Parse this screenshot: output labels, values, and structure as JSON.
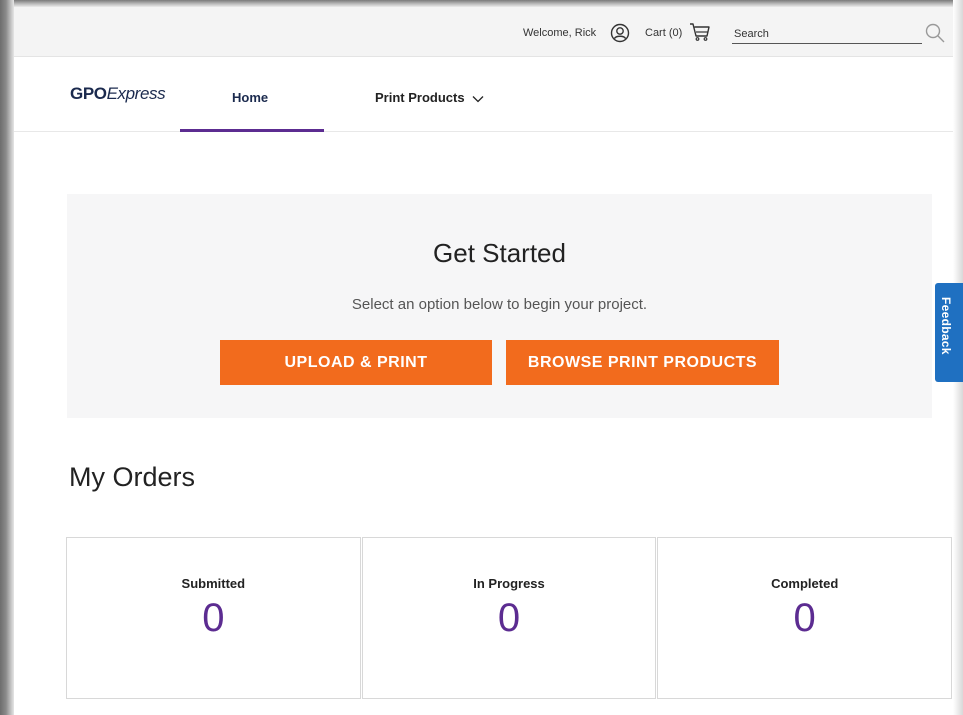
{
  "utility_bar": {
    "welcome_text": "Welcome, Rick",
    "user_icon": "user-circle-icon",
    "cart_label": "Cart (0)",
    "cart_icon": "cart-icon",
    "search_placeholder": "Search",
    "search_icon": "magnifier-icon"
  },
  "nav": {
    "logo_bold": "GPO",
    "logo_italic": "Express",
    "home_label": "Home",
    "print_products_label": "Print Products",
    "active_color": "#5c2c91"
  },
  "hero": {
    "title": "Get Started",
    "subtitle": "Select an option below to begin your project.",
    "upload_button": "UPLOAD & PRINT",
    "browse_button": "BROWSE PRINT PRODUCTS",
    "button_color": "#f26b1d"
  },
  "feedback_tab": {
    "label": "Feedback",
    "color": "#1f70c1"
  },
  "orders": {
    "title": "My Orders",
    "cards": [
      {
        "label": "Submitted",
        "count": "0"
      },
      {
        "label": "In Progress",
        "count": "0"
      },
      {
        "label": "Completed",
        "count": "0"
      }
    ]
  }
}
